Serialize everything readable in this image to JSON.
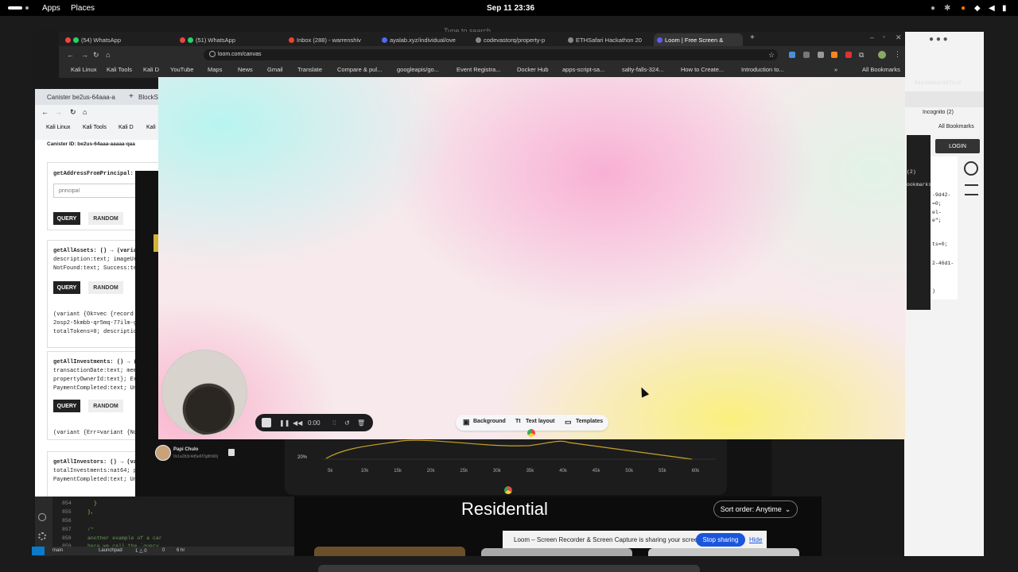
{
  "topbar": {
    "apps": "Apps",
    "places": "Places",
    "datetime": "Sep 11  23:36",
    "search_hint": "Type to search"
  },
  "browser": {
    "tabs": [
      {
        "label": "(54) WhatsApp",
        "color": "#25d366"
      },
      {
        "label": "(51) WhatsApp",
        "color": "#25d366"
      },
      {
        "label": "Inbox (288) - warrenshiv",
        "color": "#ea4335"
      },
      {
        "label": "ayalab.xyz/individual/ove",
        "color": "#4f6bed"
      },
      {
        "label": "codevastorq/property-p",
        "color": "#888888"
      },
      {
        "label": "ETHSafari Hackathon 20",
        "color": "#888888"
      },
      {
        "label": "Loom | Free Screen &",
        "color": "#625df5"
      }
    ],
    "url": "loom.com/canvas",
    "bookmarks": [
      "Kali Linux",
      "Kali Tools",
      "Kali D",
      "YouTube",
      "Maps",
      "News",
      "Gmail",
      "Translate",
      "Compare & pul...",
      "googleapis/go...",
      "Event Registra...",
      "Docker Hub",
      "apps-script-sa...",
      "salty-falls-324...",
      "How to Create...",
      "Introduction to..."
    ],
    "all_bookmarks": "All Bookmarks"
  },
  "candid": {
    "tabs": [
      "Canister be2us-64aaa-a",
      "BlockSt"
    ],
    "bookmarks": [
      "Kali Linux",
      "Kali Tools",
      "Kali D",
      "Kali"
    ],
    "canister_id": "Canister ID: be2us-64aaa-aaaaa-qaa",
    "methods": [
      {
        "name": "getAddressFromPrincipal:",
        "input_placeholder": "principal",
        "query": "QUERY",
        "random": "RANDOM"
      },
      {
        "name": "getAllAssets: () → (varia",
        "sig2": "description:text; imageUr",
        "sig3": "NotFound:text; Success:te",
        "query": "QUERY",
        "random": "RANDOM",
        "out1": "(variant {Ok=vec {record",
        "out2": "2osp2-5kmbb-qr5mq-77ilm-g",
        "out3": "totalTokens=0; descriptio"
      },
      {
        "name": "getAllInvestments: () → (",
        "sig2": "transactionDate:text; mem",
        "sig3": "propertyOwnerId:text}; Er",
        "sig4": "PaymentCompleted:text; Un",
        "query": "QUERY",
        "random": "RANDOM",
        "out1": "(variant {Err=variant {No"
      },
      {
        "name": "getAllInvestors: () → (va",
        "sig2": "totalInvestments:nat64; p",
        "sig3": "PaymentCompleted:text; Un"
      }
    ]
  },
  "loom": {
    "timer": "0:00",
    "toolbar": {
      "background": "Background",
      "text_layout": "Text layout",
      "templates": "Templates"
    }
  },
  "property_app": {
    "y_label": "20%",
    "x_ticks": [
      "5k",
      "10k",
      "15k",
      "20k",
      "25k",
      "30k",
      "35k",
      "40k",
      "45k",
      "50k",
      "55k",
      "60k"
    ],
    "user_name": "Papi Chulo",
    "user_addr": "0x1a2b3c4d5e6f7g8h9i0j",
    "section_title": "Residential",
    "sort_label": "Sort order: Anytime"
  },
  "share_bar": {
    "message": "Loom – Screen Recorder & Screen Capture is sharing your screen.",
    "stop": "Stop sharing",
    "hide": "Hide"
  },
  "incognito": {
    "label": "Incognito (2)",
    "all_bookmarks": "All Bookmarks",
    "login": "LOGIN"
  },
  "right_code": [
    "61a160bac9271c3",
    "-9d42-",
    "=0;",
    "el-",
    "e\";",
    "ts=0;",
    "2-46d1-",
    ")",
    "(2)",
    "ookmarks"
  ],
  "editor": {
    "lines": [
      "854",
      "855",
      "856",
      "857",
      "858",
      "859"
    ],
    "code": [
      "}",
      "},",
      "",
      "/*",
      "    another example of a car",
      "    here we call the `query_"
    ],
    "status": [
      "main",
      "Launchpad",
      "1 △ 0",
      "0",
      "6 hr"
    ]
  }
}
